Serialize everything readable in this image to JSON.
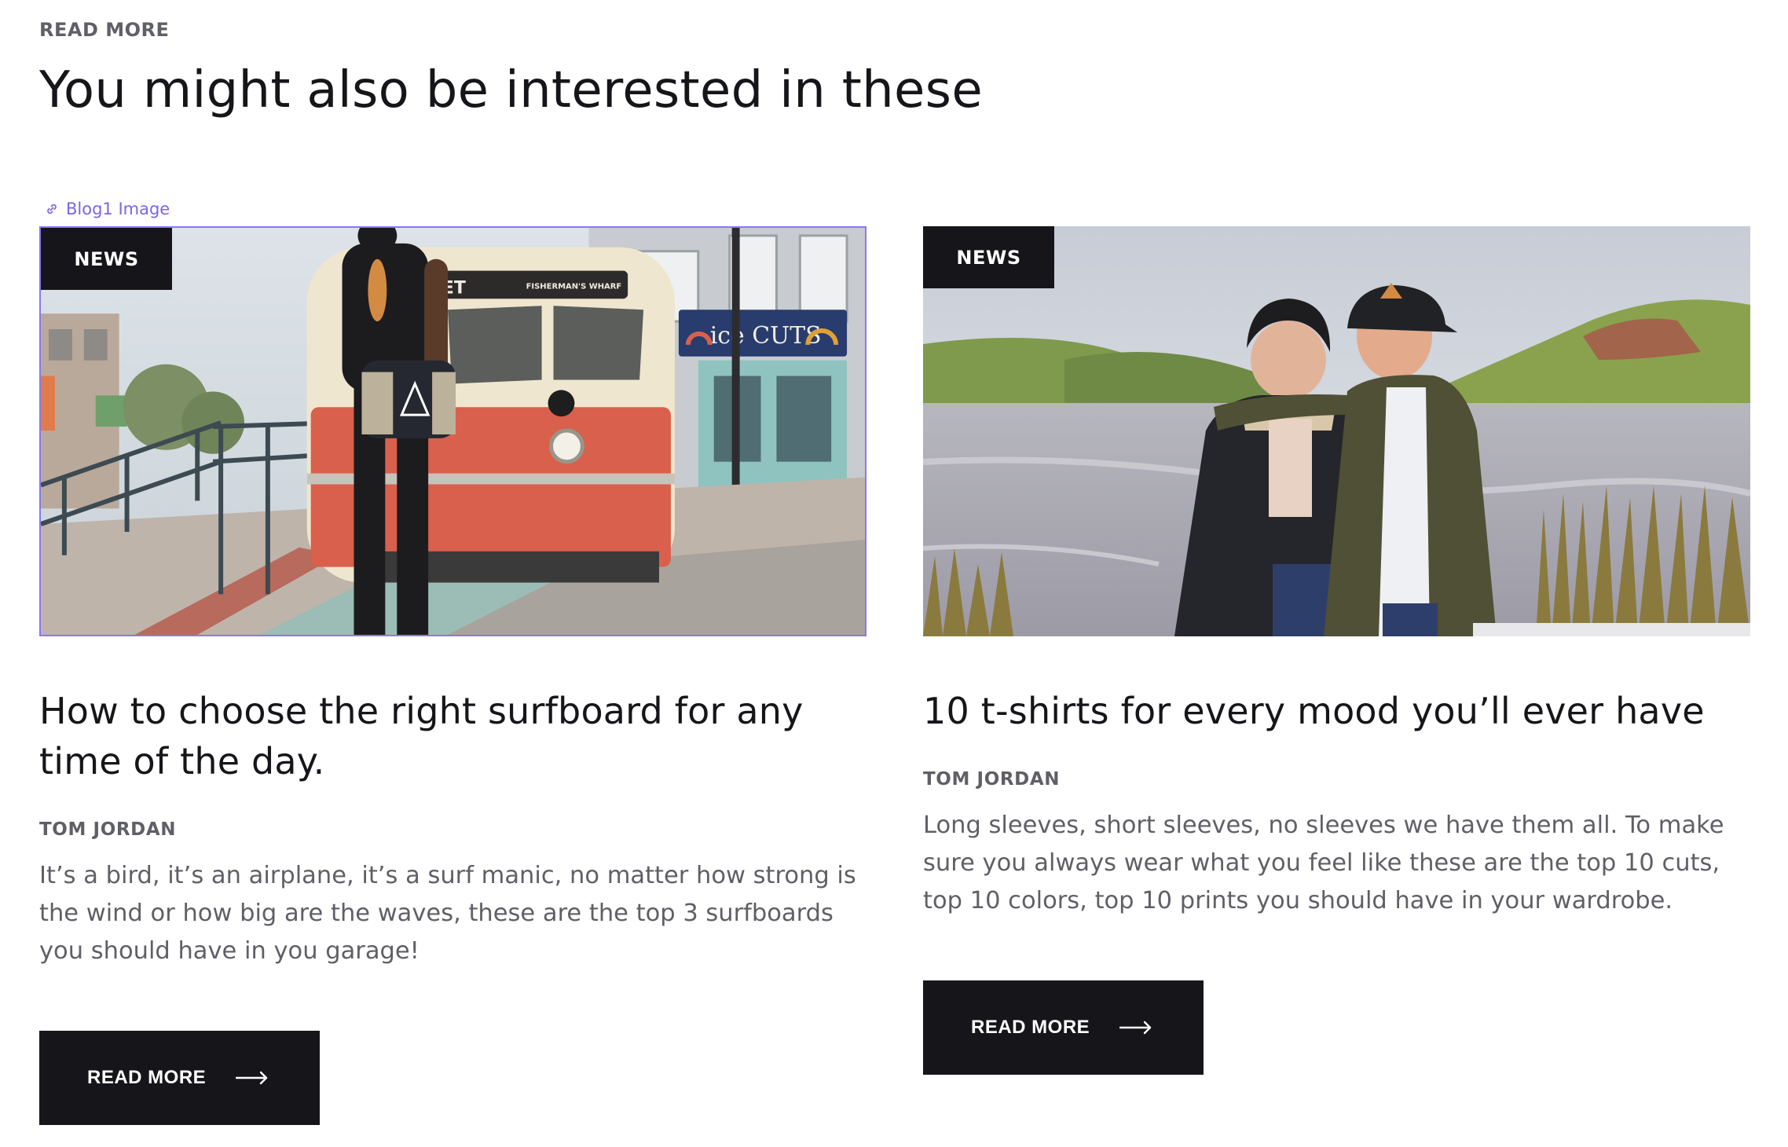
{
  "header": {
    "eyebrow": "READ MORE",
    "title": "You might also be interested in these"
  },
  "editor": {
    "selection_label": "Blog1 Image"
  },
  "posts": [
    {
      "category": "NEWS",
      "title": "How to choose the right surfboard for any time of the day.",
      "author": "TOM JORDAN",
      "excerpt": "It’s a bird, it’s an airplane, it’s a surf manic, no matter how strong is the wind or how big are the waves, these are the top 3 surfboards you should have in you garage!",
      "cta": "READ MORE",
      "image_signs": {
        "tram_sign": "MARKET",
        "tram_sign_small": "FISHERMAN'S WHARF",
        "shop_sign": "ice CUTS"
      }
    },
    {
      "category": "NEWS",
      "title": "10 t-shirts for every mood you’ll ever have",
      "author": "TOM JORDAN",
      "excerpt": "Long sleeves, short sleeves, no sleeves we have them all. To make sure you always wear what you feel like these are the top 10 cuts, top 10 colors, top 10 prints you should have in your wardrobe.",
      "cta": "READ MORE"
    }
  ],
  "colors": {
    "dark": "#16161a",
    "muted_text": "#5f5f66",
    "selection": "#8a78ee",
    "tram_red": "#d9604c",
    "tram_cream": "#efe6cf"
  },
  "icons": {
    "link": "link-icon",
    "arrow": "arrow-right-icon"
  }
}
